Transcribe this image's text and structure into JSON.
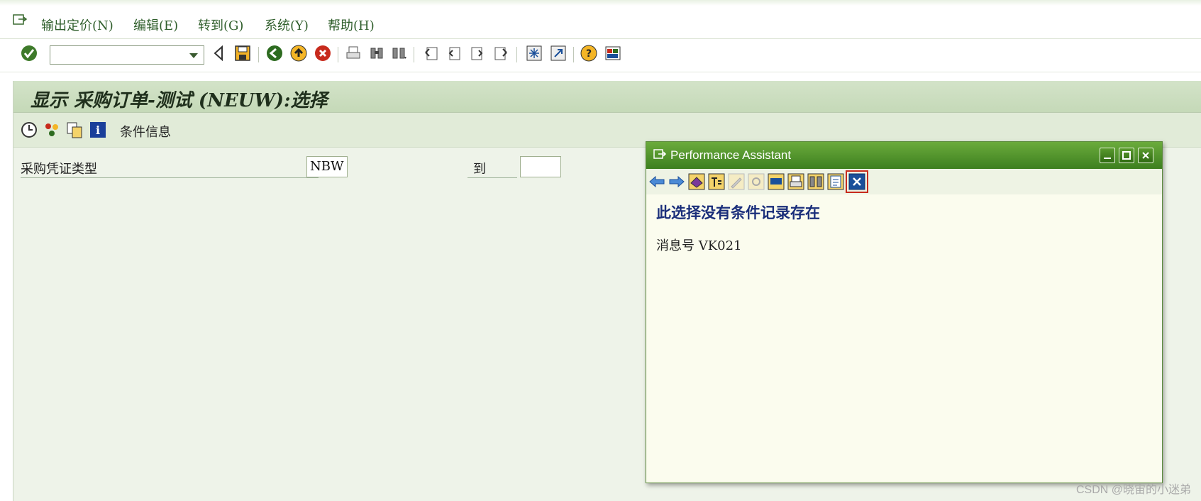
{
  "menu": {
    "items": [
      {
        "label": "输出定价(N)"
      },
      {
        "label": "编辑(E)"
      },
      {
        "label": "转到(G)"
      },
      {
        "label": "系统(Y)"
      },
      {
        "label": "帮助(H)"
      }
    ]
  },
  "toolbar": {
    "command_field_value": ""
  },
  "app": {
    "title": "显示 采购订单-测试 (NEUW):选择",
    "toolbar_condition_info": "条件信息"
  },
  "form": {
    "doc_type_label": "采购凭证类型",
    "doc_type_value": "NBW",
    "to_label": "到",
    "to_value": ""
  },
  "popup": {
    "title": "Performance Assistant",
    "heading": "此选择没有条件记录存在",
    "message": "消息号 VK021"
  },
  "watermark": "CSDN @晓宙的小迷弟",
  "colors": {
    "menu_text": "#2f5e2b",
    "title_band": "#c5d9b8",
    "popup_title": "#3d7f1f",
    "popup_heading": "#1a2e7a"
  }
}
